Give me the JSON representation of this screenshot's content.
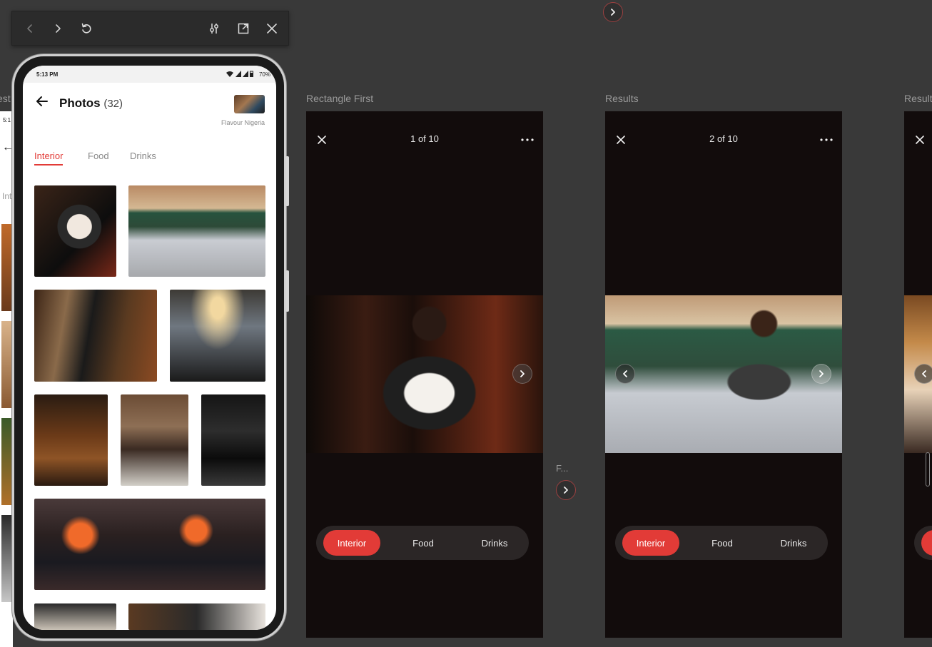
{
  "top_nav": {
    "next_label": "Next frame"
  },
  "toolbar": {
    "back": "back",
    "forward": "forward",
    "reload": "reload",
    "settings": "settings",
    "open_external": "open-external",
    "close": "close"
  },
  "frames": {
    "left_partial_label": "est",
    "rectangle_first_label": "Rectangle First",
    "results_label": "Results",
    "results_right_label": "Result",
    "middle_small_label": "F..."
  },
  "phone": {
    "status": {
      "time": "5:13 PM",
      "battery": "70%"
    },
    "header": {
      "title": "Photos",
      "count": "(32)",
      "business": "Flavour Nigeria"
    },
    "tabs": [
      {
        "label": "Interior",
        "active": true
      },
      {
        "label": "Food",
        "active": false
      },
      {
        "label": "Drinks",
        "active": false
      }
    ]
  },
  "viewer_1": {
    "counter": "1 of 10",
    "pills": [
      {
        "label": "Interior",
        "active": true
      },
      {
        "label": "Food",
        "active": false
      },
      {
        "label": "Drinks",
        "active": false
      }
    ]
  },
  "viewer_2": {
    "counter": "2 of 10",
    "pills": [
      {
        "label": "Interior",
        "active": true
      },
      {
        "label": "Food",
        "active": false
      },
      {
        "label": "Drinks",
        "active": false
      }
    ]
  },
  "left_partial": {
    "time": "5:1",
    "tab": "Int"
  },
  "colors": {
    "accent": "#e23b37",
    "viewer_bg": "#120c0c",
    "canvas_bg": "#393939"
  }
}
